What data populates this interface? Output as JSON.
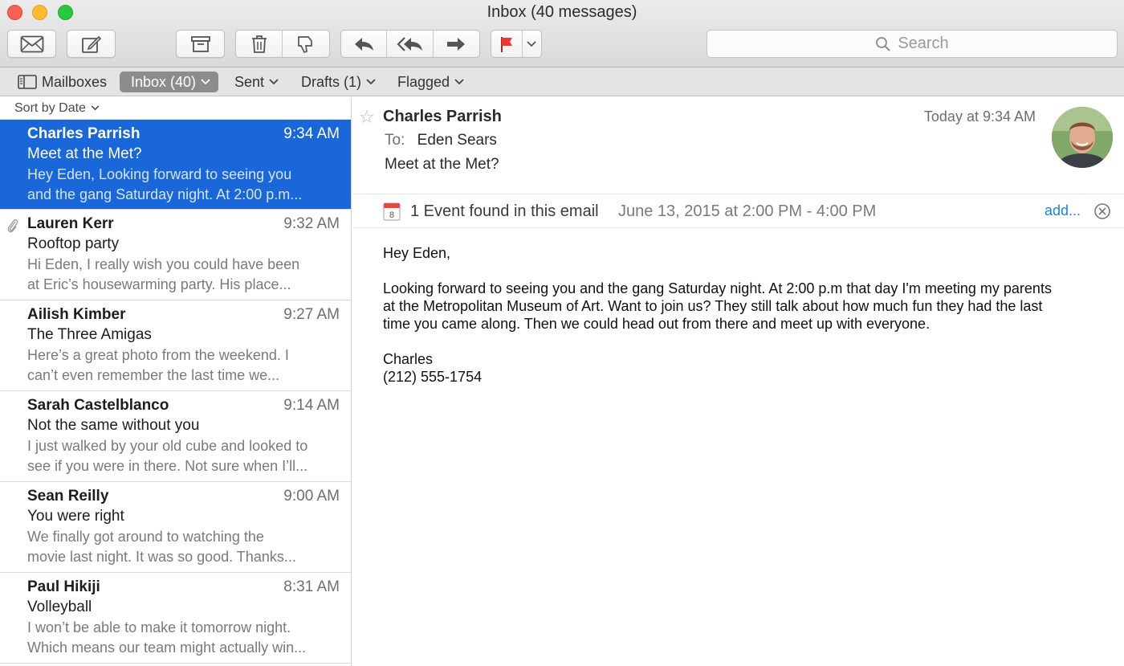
{
  "window": {
    "title": "Inbox (40 messages)"
  },
  "toolbar": {
    "search_placeholder": "Search"
  },
  "favorites": [
    {
      "label": "Mailboxes"
    },
    {
      "label": "Inbox (40)"
    },
    {
      "label": "Sent"
    },
    {
      "label": "Drafts (1)"
    },
    {
      "label": "Flagged"
    }
  ],
  "list": {
    "sort_label": "Sort by Date",
    "messages": [
      {
        "sender": "Charles Parrish",
        "time": "9:34 AM",
        "subject": "Meet at the Met?",
        "preview1": "Hey Eden, Looking forward to seeing you",
        "preview2": "and the gang Saturday night. At 2:00 p.m..."
      },
      {
        "sender": "Lauren Kerr",
        "time": "9:32 AM",
        "subject": "Rooftop party",
        "preview1": "Hi Eden, I really wish you could have been",
        "preview2": "at Eric’s housewarming party. His place..."
      },
      {
        "sender": "Ailish Kimber",
        "time": "9:27 AM",
        "subject": "The Three Amigas",
        "preview1": "Here’s a great photo from the weekend. I",
        "preview2": "can’t even remember the last time we..."
      },
      {
        "sender": "Sarah Castelblanco",
        "time": "9:14 AM",
        "subject": "Not the same without you",
        "preview1": "I just walked by your old cube and looked to",
        "preview2": "see if you were in there. Not sure when I’ll..."
      },
      {
        "sender": "Sean Reilly",
        "time": "9:00 AM",
        "subject": "You were right",
        "preview1": "We finally got around to watching the",
        "preview2": "movie last night. It was so good. Thanks..."
      },
      {
        "sender": "Paul Hikiji",
        "time": "8:31 AM",
        "subject": "Volleyball",
        "preview1": "I won’t be able to make it tomorrow night.",
        "preview2": "Which means our team might actually win..."
      }
    ]
  },
  "reader": {
    "from": "Charles Parrish",
    "date": "Today at 9:34 AM",
    "to_label": "To:",
    "to": "Eden Sears",
    "subject": "Meet at the Met?",
    "event_text": "1 Event found in this email",
    "event_date": "June 13, 2015 at 2:00 PM - 4:00 PM",
    "event_add": "add...",
    "calendar_day": "8",
    "body_greeting": "Hey Eden,",
    "body_line1": "Looking forward to seeing you and the gang Saturday night. At 2:00 p.m that day I'm meeting my parents",
    "body_line2": "at the Metropolitan Museum of Art. Want to join us? They still talk about how much fun they had the last",
    "body_line3": "time you came along. Then we could head out from there and meet up with everyone.",
    "signature_name": "Charles",
    "signature_phone": "(212) 555-1754"
  },
  "colors": {
    "selection": "#1967d8",
    "flag": "#f2362d",
    "link": "#1e84d6"
  },
  "icons": [
    "mail-icon",
    "compose-icon",
    "archive-icon",
    "trash-icon",
    "junk-icon",
    "reply-icon",
    "reply-all-icon",
    "forward-icon",
    "flag-icon",
    "search-icon",
    "sidebar-icon",
    "attachment-icon",
    "star-icon",
    "calendar-icon",
    "close-circle-icon"
  ]
}
